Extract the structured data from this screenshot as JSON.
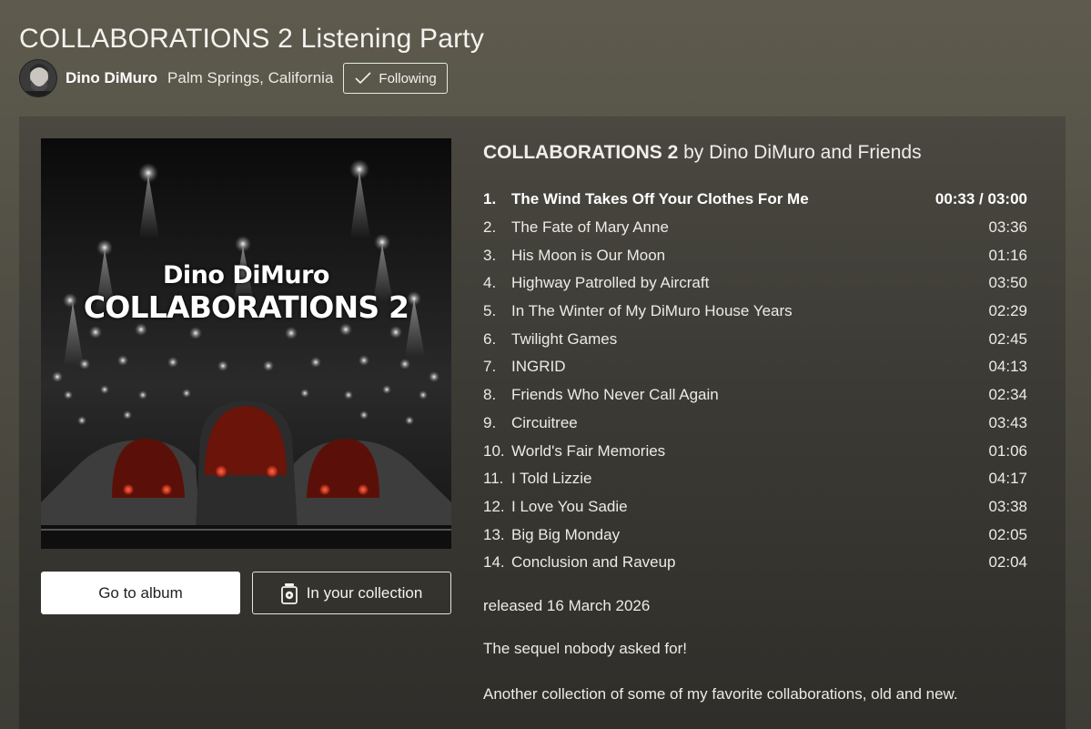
{
  "header": {
    "title": "COLLABORATIONS 2 Listening Party"
  },
  "user": {
    "name": "Dino DiMuro",
    "location": "Palm Springs, California",
    "follow_label": "Following"
  },
  "cover": {
    "artist": "Dino DiMuro",
    "album": "COLLABORATIONS 2"
  },
  "buttons": {
    "go_to_album": "Go to album",
    "in_collection": "In your collection"
  },
  "album": {
    "title": "COLLABORATIONS 2",
    "by_text": "by Dino DiMuro and Friends",
    "released": "released 16 March 2026",
    "description_1": "The sequel nobody asked for!",
    "description_2": "Another collection of some of my favorite collaborations, old and new."
  },
  "tracks": [
    {
      "num": "1.",
      "title": "The Wind Takes Off Your Clothes For Me",
      "time": "00:33 / 03:00",
      "current": true
    },
    {
      "num": "2.",
      "title": "The Fate of Mary Anne",
      "time": "03:36"
    },
    {
      "num": "3.",
      "title": "His Moon is Our Moon",
      "time": "01:16"
    },
    {
      "num": "4.",
      "title": "Highway Patrolled by Aircraft",
      "time": "03:50"
    },
    {
      "num": "5.",
      "title": "In The Winter of My DiMuro House Years",
      "time": "02:29"
    },
    {
      "num": "6.",
      "title": "Twilight Games",
      "time": "02:45"
    },
    {
      "num": "7.",
      "title": "INGRID",
      "time": "04:13"
    },
    {
      "num": "8.",
      "title": "Friends Who Never Call Again",
      "time": "02:34"
    },
    {
      "num": "9.",
      "title": "Circuitree",
      "time": "03:43"
    },
    {
      "num": "10.",
      "title": "World's Fair Memories",
      "time": "01:06"
    },
    {
      "num": "11.",
      "title": "I Told Lizzie",
      "time": "04:17"
    },
    {
      "num": "12.",
      "title": "I Love You Sadie",
      "time": "03:38"
    },
    {
      "num": "13.",
      "title": "Big Big Monday",
      "time": "02:05"
    },
    {
      "num": "14.",
      "title": "Conclusion and Raveup",
      "time": "02:04"
    }
  ],
  "icons": {
    "follow": "checkmark-icon",
    "collection": "collection-icon"
  }
}
